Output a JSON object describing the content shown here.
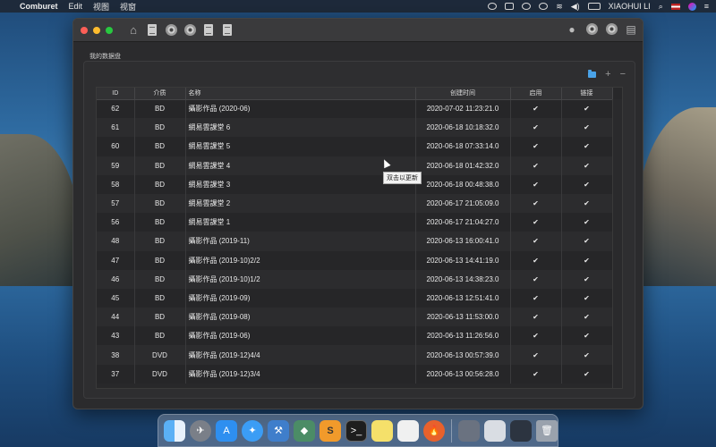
{
  "menubar": {
    "apple": "",
    "app_name": "Comburet",
    "menus": [
      "Edit",
      "视图",
      "视窗"
    ],
    "user": "XIAOHUI LI"
  },
  "window": {
    "group_label": "我的数据盘",
    "table": {
      "columns": [
        "ID",
        "介质",
        "名称",
        "创建时间",
        "启用",
        "链接"
      ],
      "rows": [
        {
          "id": "62",
          "type": "BD",
          "name": "攝影作品 (2020-06)",
          "time": "2020-07-02 11:23:21.0",
          "enabled": "✔",
          "link": "✔"
        },
        {
          "id": "61",
          "type": "BD",
          "name": "網易雲課堂 6",
          "time": "2020-06-18 10:18:32.0",
          "enabled": "✔",
          "link": "✔"
        },
        {
          "id": "60",
          "type": "BD",
          "name": "網易雲課堂 5",
          "time": "2020-06-18 07:33:14.0",
          "enabled": "✔",
          "link": "✔"
        },
        {
          "id": "59",
          "type": "BD",
          "name": "網易雲課堂 4",
          "time": "2020-06-18 01:42:32.0",
          "enabled": "✔",
          "link": "✔"
        },
        {
          "id": "58",
          "type": "BD",
          "name": "網易雲課堂 3",
          "time": "2020-06-18 00:48:38.0",
          "enabled": "✔",
          "link": "✔"
        },
        {
          "id": "57",
          "type": "BD",
          "name": "網易雲課堂 2",
          "time": "2020-06-17 21:05:09.0",
          "enabled": "✔",
          "link": "✔"
        },
        {
          "id": "56",
          "type": "BD",
          "name": "網易雲課堂 1",
          "time": "2020-06-17 21:04:27.0",
          "enabled": "✔",
          "link": "✔"
        },
        {
          "id": "48",
          "type": "BD",
          "name": "攝影作品 (2019-11)",
          "time": "2020-06-13 16:00:41.0",
          "enabled": "✔",
          "link": "✔"
        },
        {
          "id": "47",
          "type": "BD",
          "name": "攝影作品 (2019-10)2/2",
          "time": "2020-06-13 14:41:19.0",
          "enabled": "✔",
          "link": "✔"
        },
        {
          "id": "46",
          "type": "BD",
          "name": "攝影作品 (2019-10)1/2",
          "time": "2020-06-13 14:38:23.0",
          "enabled": "✔",
          "link": "✔"
        },
        {
          "id": "45",
          "type": "BD",
          "name": "攝影作品 (2019-09)",
          "time": "2020-06-13 12:51:41.0",
          "enabled": "✔",
          "link": "✔"
        },
        {
          "id": "44",
          "type": "BD",
          "name": "攝影作品 (2019-08)",
          "time": "2020-06-13 11:53:00.0",
          "enabled": "✔",
          "link": "✔"
        },
        {
          "id": "43",
          "type": "BD",
          "name": "攝影作品 (2019-06)",
          "time": "2020-06-13 11:26:56.0",
          "enabled": "✔",
          "link": "✔"
        },
        {
          "id": "38",
          "type": "DVD",
          "name": "攝影作品 (2019-12)4/4",
          "time": "2020-06-13 00:57:39.0",
          "enabled": "✔",
          "link": "✔"
        },
        {
          "id": "37",
          "type": "DVD",
          "name": "攝影作品 (2019-12)3/4",
          "time": "2020-06-13 00:56:28.0",
          "enabled": "✔",
          "link": "✔"
        }
      ]
    },
    "tooltip": "双击以更新"
  },
  "colors": {
    "window_bg": "#2b2b2d",
    "accent_folder": "#4aa3e8"
  },
  "dock": {
    "apps": [
      "finder-icon",
      "launchpad-icon",
      "app-store-icon",
      "safari-icon",
      "xcode-icon",
      "android-studio-icon",
      "sublime-text-icon",
      "terminal-icon",
      "notes-icon",
      "textedit-icon",
      "comburet-icon",
      "downloads-icon",
      "mail-icon",
      "screenshots-icon",
      "trash-icon"
    ]
  }
}
